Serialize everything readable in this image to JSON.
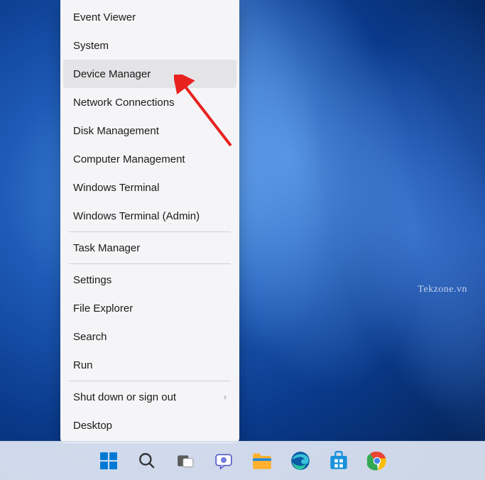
{
  "watermark": "Tekzone.vn",
  "menu": {
    "items": [
      {
        "label": "Event Viewer",
        "hover": false,
        "hasSubmenu": false
      },
      {
        "label": "System",
        "hover": false,
        "hasSubmenu": false
      },
      {
        "label": "Device Manager",
        "hover": true,
        "hasSubmenu": false
      },
      {
        "label": "Network Connections",
        "hover": false,
        "hasSubmenu": false
      },
      {
        "label": "Disk Management",
        "hover": false,
        "hasSubmenu": false
      },
      {
        "label": "Computer Management",
        "hover": false,
        "hasSubmenu": false
      },
      {
        "label": "Windows Terminal",
        "hover": false,
        "hasSubmenu": false
      },
      {
        "label": "Windows Terminal (Admin)",
        "hover": false,
        "hasSubmenu": false
      },
      {
        "separator": true
      },
      {
        "label": "Task Manager",
        "hover": false,
        "hasSubmenu": false
      },
      {
        "separator": true
      },
      {
        "label": "Settings",
        "hover": false,
        "hasSubmenu": false
      },
      {
        "label": "File Explorer",
        "hover": false,
        "hasSubmenu": false
      },
      {
        "label": "Search",
        "hover": false,
        "hasSubmenu": false
      },
      {
        "label": "Run",
        "hover": false,
        "hasSubmenu": false
      },
      {
        "separator": true
      },
      {
        "label": "Shut down or sign out",
        "hover": false,
        "hasSubmenu": true
      },
      {
        "label": "Desktop",
        "hover": false,
        "hasSubmenu": false
      }
    ]
  },
  "taskbar": {
    "icons": [
      {
        "name": "start-icon"
      },
      {
        "name": "search-icon"
      },
      {
        "name": "taskview-icon"
      },
      {
        "name": "chat-icon"
      },
      {
        "name": "explorer-icon"
      },
      {
        "name": "edge-icon"
      },
      {
        "name": "store-icon"
      },
      {
        "name": "chrome-icon"
      }
    ]
  }
}
